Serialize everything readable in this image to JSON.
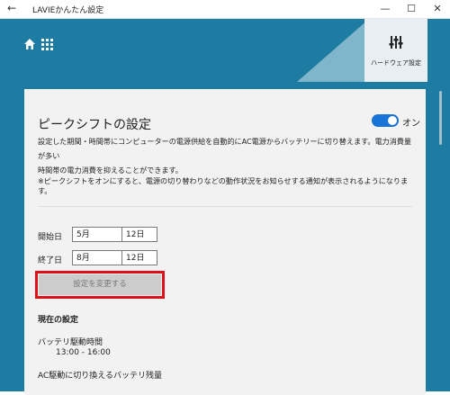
{
  "window": {
    "title": "LAVIEかんたん設定",
    "back_icon": "arrow-left-icon",
    "minimize_glyph": "—",
    "maximize_glyph": "☐",
    "close_glyph": "✕"
  },
  "header": {
    "home_icon": "home-icon",
    "apps_icon": "grid-icon",
    "hardware_tile_label": "ハードウェア設定",
    "hardware_tile_icon": "sliders-icon",
    "colors": {
      "app_bg": "#1e7ba1",
      "tile_bg": "#e8eef2",
      "triangle": "#7fb6cc"
    }
  },
  "panel": {
    "title": "ピークシフトの設定",
    "toggle_state": "on",
    "toggle_label": "オン",
    "description_line1": "設定した期間・時間帯にコンピューターの電源供給を自動的にAC電源からバッテリーに切り替えます。電力消費量が多い",
    "description_line2": "時間帯の電力消費を抑えることができます。",
    "note": "※ピークシフトをオンにすると、電源の切り替わりなどの動作状況をお知らせする通知が表示されるようになります。",
    "start_label": "開始日",
    "start_month": "5月",
    "start_day": "12日",
    "end_label": "終了日",
    "end_month": "8月",
    "end_day": "12日",
    "apply_button": "設定を変更する",
    "current_heading": "現在の設定",
    "battery_label": "バッテリ駆動時間",
    "battery_value": "13:00 - 16:00",
    "ac_switch_label": "AC駆動に切り換えるバッテリ残量",
    "highlight_color": "#e0101b",
    "toggle_color": "#1a73d6"
  }
}
